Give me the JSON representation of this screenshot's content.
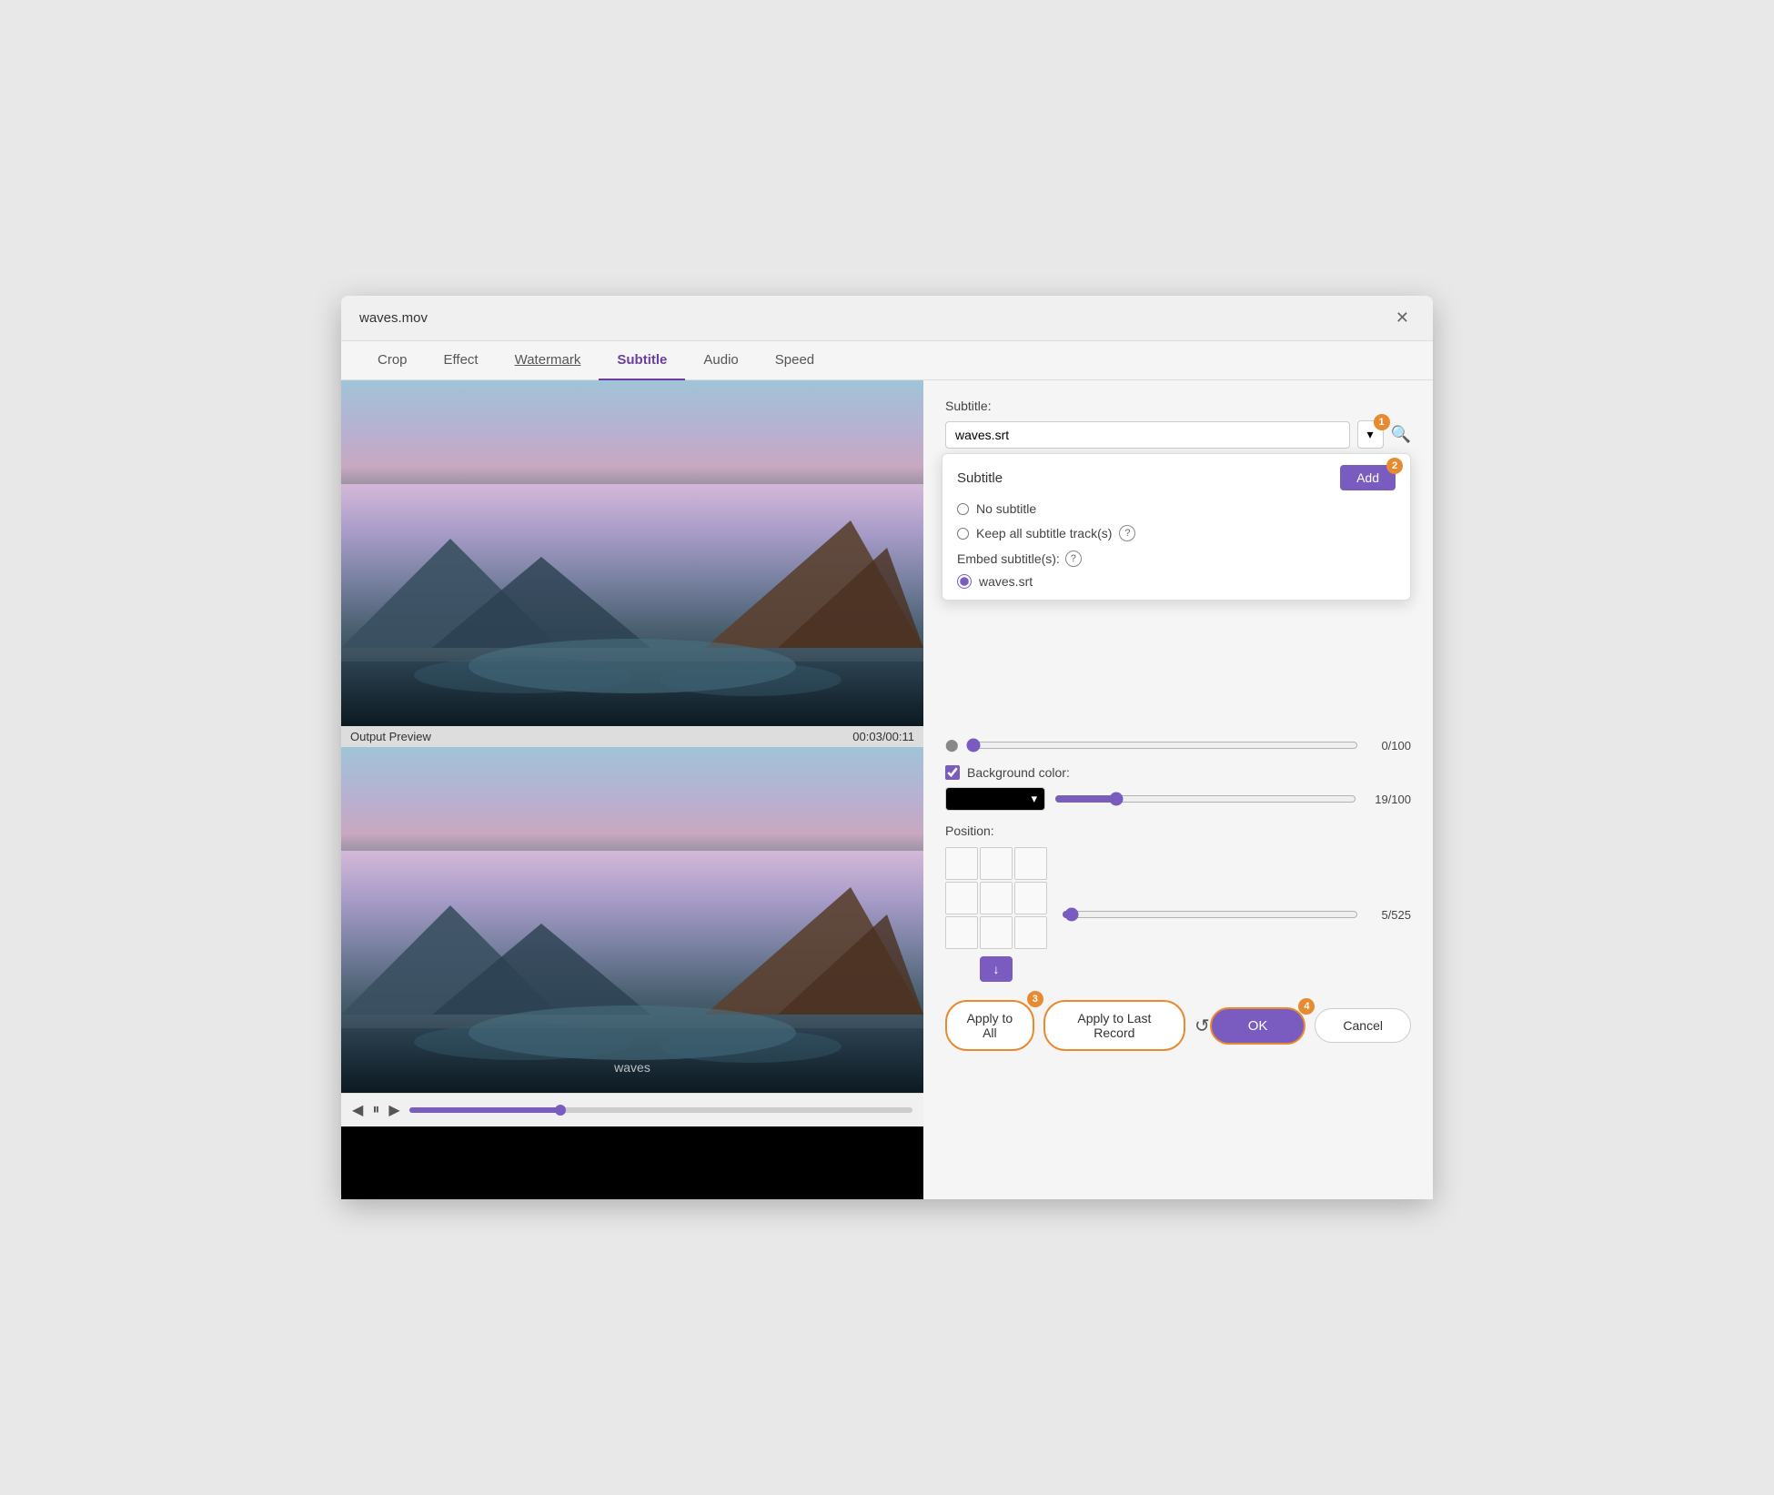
{
  "titleBar": {
    "title": "waves.mov",
    "closeLabel": "✕"
  },
  "tabs": [
    {
      "id": "crop",
      "label": "Crop",
      "active": false
    },
    {
      "id": "effect",
      "label": "Effect",
      "active": false
    },
    {
      "id": "watermark",
      "label": "Watermark",
      "active": false,
      "underline": true
    },
    {
      "id": "subtitle",
      "label": "Subtitle",
      "active": true
    },
    {
      "id": "audio",
      "label": "Audio",
      "active": false
    },
    {
      "id": "speed",
      "label": "Speed",
      "active": false
    }
  ],
  "leftPanel": {
    "outputPreviewLabel": "Output Preview",
    "timestamp": "00:03/00:11",
    "watermarkText": "waves",
    "playPrevLabel": "◀",
    "pauseLabel": "⏸",
    "playNextLabel": "▶"
  },
  "rightPanel": {
    "subtitleSectionLabel": "Subtitle:",
    "subtitleInputValue": "waves.srt",
    "dropdownBadge": "1",
    "addBadge": "2",
    "dropdown": {
      "title": "Subtitle",
      "addBtnLabel": "Add",
      "options": [
        {
          "id": "no-subtitle",
          "label": "No subtitle",
          "type": "radio"
        },
        {
          "id": "keep-all",
          "label": "Keep all subtitle track(s)",
          "type": "radio",
          "hasHelp": true
        },
        {
          "id": "embed-label",
          "label": "Embed subtitle(s):",
          "type": "label",
          "hasHelp": true
        },
        {
          "id": "waves-srt",
          "label": "waves.srt",
          "type": "radio",
          "selected": true
        }
      ]
    },
    "opacitySlider": {
      "value": "0/100"
    },
    "backgroundColorLabel": "Background color:",
    "bgColorValue": "19/100",
    "positionLabel": "Position:",
    "positionSliderValue": "5/525",
    "buttons": {
      "applyToAll": "Apply to All",
      "applyToLastRecord": "Apply to Last Record",
      "applyBadge": "3",
      "ok": "OK",
      "okBadge": "4",
      "cancel": "Cancel"
    }
  }
}
